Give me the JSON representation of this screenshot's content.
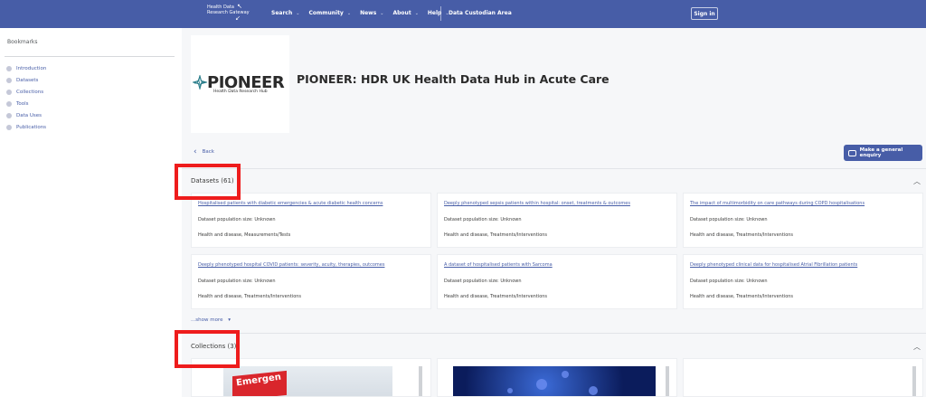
{
  "nav": {
    "logo_lines": [
      "Health Data",
      "Research Gateway"
    ],
    "items": [
      {
        "label": "Search",
        "has_dropdown": true
      },
      {
        "label": "Community",
        "has_dropdown": true
      },
      {
        "label": "News",
        "has_dropdown": true
      },
      {
        "label": "About",
        "has_dropdown": true
      },
      {
        "label": "Help",
        "has_dropdown": true
      }
    ],
    "custodian_area": "Data Custodian Area",
    "sign_in": "Sign in"
  },
  "sidebar": {
    "title": "Bookmarks",
    "items": [
      {
        "label": "Introduction"
      },
      {
        "label": "Datasets"
      },
      {
        "label": "Collections"
      },
      {
        "label": "Tools"
      },
      {
        "label": "Data Uses"
      },
      {
        "label": "Publications"
      }
    ]
  },
  "hub": {
    "logo_word": "PIONEER",
    "logo_sub": "Health Data Research Hub",
    "title": "PIONEER: HDR UK Health Data Hub in Acute Care"
  },
  "actions": {
    "back": "Back",
    "enquiry": "Make a general enquiry"
  },
  "datasets": {
    "heading": "Datasets (61)",
    "cards": [
      {
        "title": "Hospitalised patients with diabetic emergencies & acute diabetic health concerns",
        "population": "Dataset population size: Unknown",
        "tags": "Health and disease, Measurements/Tests"
      },
      {
        "title": "Deeply phenotyped sepsis patients within hospital: onset, treatments & outcomes",
        "population": "Dataset population size: Unknown",
        "tags": "Health and disease, Treatments/Interventions"
      },
      {
        "title": "The impact of multimorbidity on care pathways during COPD hospitalisations",
        "population": "Dataset population size: Unknown",
        "tags": "Health and disease, Treatments/Interventions"
      },
      {
        "title": "Deeply phenotyped hospital COVID patients: severity, acuity, therapies, outcomes",
        "population": "Dataset population size: Unknown",
        "tags": "Health and disease, Treatments/Interventions"
      },
      {
        "title": "A dataset of hospitalised patients with Sarcoma",
        "population": "Dataset population size: Unknown",
        "tags": "Health and disease, Treatments/Interventions"
      },
      {
        "title": "Deeply phenotyped clinical data for hospitalised Atrial Fibrillation patients",
        "population": "Dataset population size: Unknown",
        "tags": "Health and disease, Treatments/Interventions"
      }
    ],
    "show_more": "...show more"
  },
  "collections": {
    "heading": "Collections (3)",
    "sign_text": "Emergen"
  },
  "colors": {
    "brand": "#475da7",
    "highlight": "#ee1c1c"
  }
}
